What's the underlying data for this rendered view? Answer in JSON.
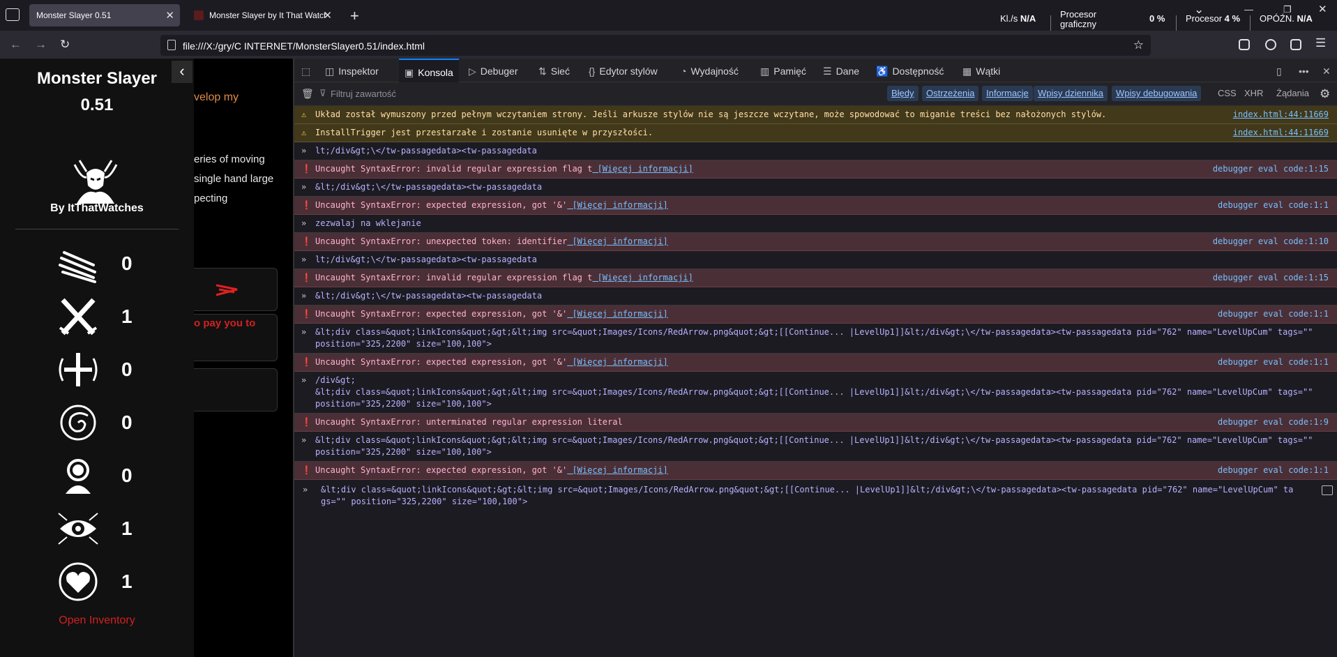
{
  "browser": {
    "tabs": [
      {
        "label": "Monster Slayer 0.51",
        "active": true
      },
      {
        "label": "Monster Slayer by It That Watch",
        "active": false
      }
    ],
    "new_tab": "+",
    "url": "file:///X:/gry/C INTERNET/MonsterSlayer0.51/index.html",
    "meters": {
      "kl_label": "Kl./s",
      "kl_value": "N/A",
      "gpu_label": "Procesor graficzny",
      "gpu_value": "0 %",
      "cpu_label": "Procesor",
      "cpu_value": "4 %",
      "lag_label": "OPÓŹN.",
      "lag_value": "N/A"
    }
  },
  "game": {
    "title": "Monster Slayer 0.51",
    "author": "By ItThatWatches",
    "stats": [
      {
        "icon": "claw-slash-icon",
        "value": "0"
      },
      {
        "icon": "crossed-swords-icon",
        "value": "1"
      },
      {
        "icon": "cross-icon",
        "value": "0"
      },
      {
        "icon": "spiral-icon",
        "value": "0"
      },
      {
        "icon": "person-icon",
        "value": "0"
      },
      {
        "icon": "eye-icon",
        "value": "1"
      },
      {
        "icon": "heart-icon",
        "value": "1"
      }
    ],
    "open_inventory": "Open Inventory",
    "story_lines": [
      "velop my",
      "eries of moving",
      "single hand large",
      "pecting"
    ],
    "story_box_text": "o pay you to"
  },
  "devtools": {
    "tabs": [
      "Inspektor",
      "Konsola",
      "Debuger",
      "Sieć",
      "Edytor stylów",
      "Wydajność",
      "Pamięć",
      "Dane",
      "Dostępność",
      "Wątki"
    ],
    "active_tab": "Konsola",
    "filter_placeholder": "Filtruj zawartość",
    "filters": [
      {
        "label": "Błędy",
        "on": true
      },
      {
        "label": "Ostrzeżenia",
        "on": true
      },
      {
        "label": "Informacje",
        "on": true
      },
      {
        "label": "Wpisy dziennika",
        "on": true
      },
      {
        "label": "Wpisy debugowania",
        "on": true
      },
      {
        "label": "CSS",
        "on": false
      },
      {
        "label": "XHR",
        "on": false
      },
      {
        "label": "Żądania",
        "on": false
      }
    ],
    "messages": [
      {
        "type": "warn",
        "text": "Układ został wymuszony przed pełnym wczytaniem strony. Jeśli arkusze stylów nie są jeszcze wczytane, może spowodować to miganie treści bez nałożonych stylów.",
        "src": "index.html:44:11669"
      },
      {
        "type": "warn",
        "text": "InstallTrigger jest przestarzałe i zostanie usunięte w przyszłości.",
        "src": "index.html:44:11669"
      },
      {
        "type": "in",
        "text": "lt;/div&gt;\\</tw-passagedata><tw-passagedata",
        "src": ""
      },
      {
        "type": "err",
        "text": "Uncaught SyntaxError: invalid regular expression flag t",
        "more": "[Więcej informacji]",
        "src": "debugger eval code:1:15"
      },
      {
        "type": "in",
        "text": "&lt;/div&gt;\\</tw-passagedata><tw-passagedata",
        "src": ""
      },
      {
        "type": "err",
        "text": "Uncaught SyntaxError: expected expression, got '&'",
        "more": "[Więcej informacji]",
        "src": "debugger eval code:1:1"
      },
      {
        "type": "in",
        "text": "zezwalaj na wklejanie",
        "src": ""
      },
      {
        "type": "err",
        "text": "Uncaught SyntaxError: unexpected token: identifier",
        "more": "[Więcej informacji]",
        "src": "debugger eval code:1:10"
      },
      {
        "type": "in",
        "text": "lt;/div&gt;\\</tw-passagedata><tw-passagedata",
        "src": ""
      },
      {
        "type": "err",
        "text": "Uncaught SyntaxError: invalid regular expression flag t",
        "more": "[Więcej informacji]",
        "src": "debugger eval code:1:15"
      },
      {
        "type": "in",
        "text": "&lt;/div&gt;\\</tw-passagedata><tw-passagedata",
        "src": ""
      },
      {
        "type": "err",
        "text": "Uncaught SyntaxError: expected expression, got '&'",
        "more": "[Więcej informacji]",
        "src": "debugger eval code:1:1"
      },
      {
        "type": "in",
        "text": "&lt;div class=&quot;linkIcons&quot;&gt;&lt;img src=&quot;Images/Icons/RedArrow.png&quot;&gt;[[Continue... |LevelUp1]]&lt;/div&gt;\\</tw-passagedata><tw-passagedata pid=\"762\" name=\"LevelUpCum\" tags=\"\" position=\"325,2200\" size=\"100,100\">",
        "src": ""
      },
      {
        "type": "err",
        "text": "Uncaught SyntaxError: expected expression, got '&'",
        "more": "[Więcej informacji]",
        "src": "debugger eval code:1:1"
      },
      {
        "type": "in",
        "text": "/div&gt;\n&lt;div class=&quot;linkIcons&quot;&gt;&lt;img src=&quot;Images/Icons/RedArrow.png&quot;&gt;[[Continue... |LevelUp1]]&lt;/div&gt;\\</tw-passagedata><tw-passagedata pid=\"762\" name=\"LevelUpCum\" tags=\"\" position=\"325,2200\" size=\"100,100\">",
        "src": ""
      },
      {
        "type": "err",
        "text": "Uncaught SyntaxError: unterminated regular expression literal",
        "more": "",
        "src": "debugger eval code:1:9"
      },
      {
        "type": "in",
        "text": "&lt;div class=&quot;linkIcons&quot;&gt;&lt;img src=&quot;Images/Icons/RedArrow.png&quot;&gt;[[Continue... |LevelUp1]]&lt;/div&gt;\\</tw-passagedata><tw-passagedata pid=\"762\" name=\"LevelUpCum\" tags=\"\" position=\"325,2200\" size=\"100,100\">",
        "src": ""
      },
      {
        "type": "err",
        "text": "Uncaught SyntaxError: expected expression, got '&'",
        "more": "[Więcej informacji]",
        "src": "debugger eval code:1:1"
      }
    ],
    "input": "&lt;div class=&quot;linkIcons&quot;&gt;&lt;img src=&quot;Images/Icons/RedArrow.png&quot;&gt;[[Continue... |LevelUp1]]&lt;/div&gt;\\</tw-passagedata><tw-passagedata pid=\"762\" name=\"LevelUpCum\" tags=\"\" position=\"325,2200\" size=\"100,100\">"
  }
}
